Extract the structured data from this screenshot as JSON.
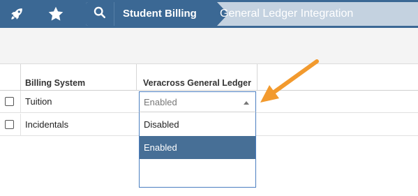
{
  "topbar": {
    "rocket_icon": "rocket-icon",
    "star_icon": "star-icon",
    "search_icon": "search-icon",
    "breadcrumb": {
      "parent": "Student Billing",
      "current": "General Ledger Integration"
    }
  },
  "grid": {
    "columns": [
      "Billing System",
      "Veracross General Ledger"
    ],
    "rows": [
      {
        "label": "Tuition",
        "checked": false
      },
      {
        "label": "Incidentals",
        "checked": false
      }
    ]
  },
  "select": {
    "value": "Enabled",
    "options": [
      "Disabled",
      "Enabled"
    ],
    "highlighted": "Enabled"
  },
  "colors": {
    "topbar": "#3b6894",
    "breadcrumb_inactive": "#c4d2e0",
    "selected_option": "#476f96",
    "focus_border": "#4a7ec0",
    "annotation_arrow": "#f29a2e"
  }
}
